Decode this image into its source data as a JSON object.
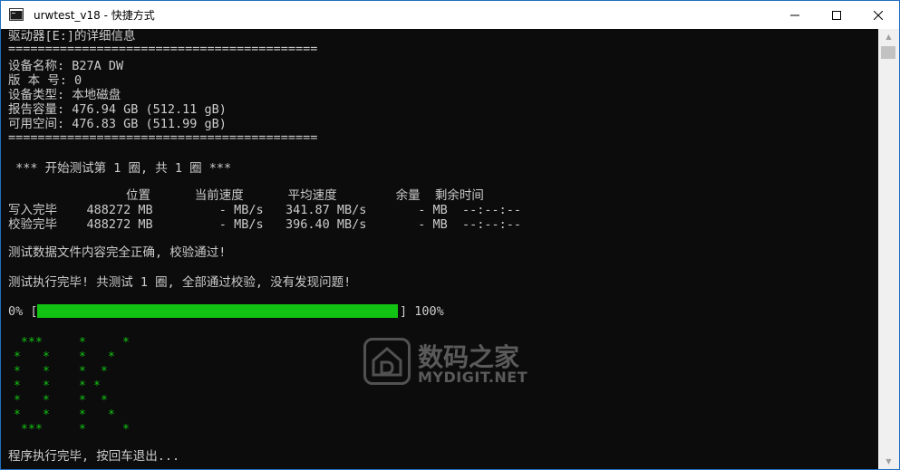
{
  "window": {
    "title": "urwtest_v18 - 快捷方式"
  },
  "console": {
    "lines": [
      "驱动器[E:]的详细信息",
      "==========================================",
      "设备名称: B27A DW",
      "版 本 号: 0",
      "设备类型: 本地磁盘",
      "报告容量: 476.94 GB (512.11 gB)",
      "可用空间: 476.83 GB (511.99 gB)",
      "==========================================",
      " *** 开始测试第 1 圈, 共 1 圈 ***",
      "                位置      当前速度      平均速度        余量  剩余时间",
      "写入完毕    488272 MB         - MB/s   341.87 MB/s       - MB  --:--:--",
      "校验完毕    488272 MB         - MB/s   396.40 MB/s       - MB  --:--:--",
      "测试数据文件内容完全正确, 校验通过!",
      "测试执行完毕! 共测试 1 圈, 全部通过校验, 没有发现问题!",
      "程序执行完毕, 按回车退出..."
    ],
    "progress": {
      "prefix": "0% [",
      "suffix": "] 100%",
      "fraction": 1.0
    },
    "ok_art_char": "*"
  },
  "watermark": {
    "cn": "数码之家",
    "en": "MYDIGIT.NET"
  },
  "colors": {
    "console_bg": "#0c0c0c",
    "console_text": "#cccccc",
    "accent_green": "#13c313"
  }
}
